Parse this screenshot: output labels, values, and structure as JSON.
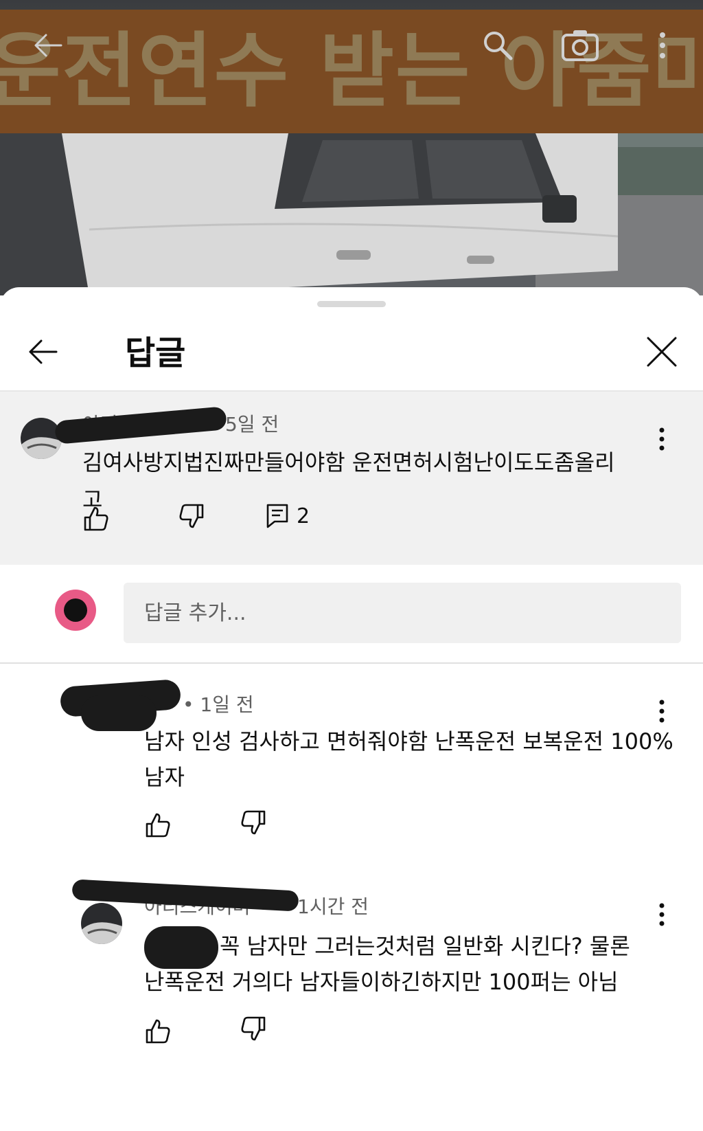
{
  "video": {
    "banner_text": "운전연수 받는 아줌마"
  },
  "sheet": {
    "title": "답글"
  },
  "parent_comment": {
    "author": "아리스",
    "time": "5일 전",
    "text": "김여사방지법진짜만들어야함 운전면허시험난이도도좀올리고",
    "reply_count": "2"
  },
  "add_reply": {
    "placeholder": "답글 추가..."
  },
  "replies": [
    {
      "author": "",
      "time": "• 1일 전",
      "text_line1": "남자 인성 검사하고 면허줘야함 난폭운전 보복운전 100%",
      "text_line2": "남자"
    },
    {
      "author": "아리스게이머",
      "time": "1시간 전",
      "text_line1": "꼭 남자만 그러는것처럼 일반화 시킨다? 물론",
      "text_line2": "난폭운전 거의다 남자들이하긴하지만 100퍼는 아님"
    }
  ],
  "colors": {
    "sheet_bg": "#ffffff",
    "parent_bg": "#f1f1f1",
    "input_bg": "#f0f0f0",
    "user_avatar": "#e85a86",
    "meta_text": "#606060"
  },
  "icons": {
    "video_back": "arrow-left-icon",
    "video_search": "search-icon",
    "video_camera": "camera-icon",
    "video_more": "more-vertical-icon",
    "sheet_back": "arrow-left-icon",
    "sheet_close": "close-icon",
    "like": "thumbs-up-icon",
    "dislike": "thumbs-down-icon",
    "replies": "comment-icon",
    "comment_more": "more-vertical-icon"
  }
}
